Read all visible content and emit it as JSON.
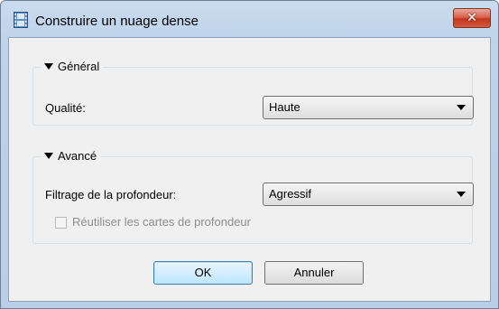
{
  "window": {
    "title": "Construire un nuage dense",
    "close_glyph": "✕",
    "icon": "film-strip-icon"
  },
  "general": {
    "legend": "Général",
    "quality_label": "Qualité:",
    "quality_value": "Haute"
  },
  "advanced": {
    "legend": "Avancé",
    "depth_filter_label": "Filtrage de la profondeur:",
    "depth_filter_value": "Agressif",
    "reuse_depth_label": "Réutiliser les cartes de profondeur",
    "reuse_depth_checked": false,
    "reuse_depth_enabled": false
  },
  "buttons": {
    "ok": "OK",
    "cancel": "Annuler"
  },
  "colors": {
    "title_bar": "#c9dbee",
    "dialog_bg": "#f0f0f0",
    "close_button": "#c4361c",
    "default_button_border": "#3c7fb1"
  }
}
